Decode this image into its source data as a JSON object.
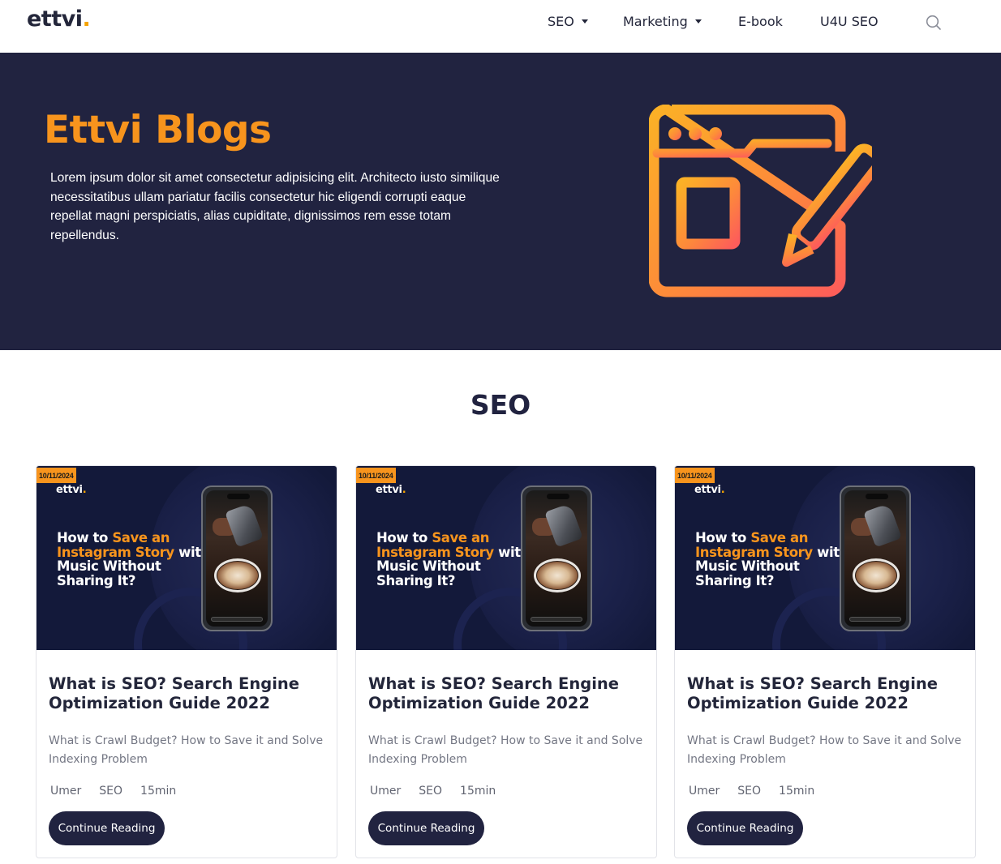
{
  "navbar": {
    "logo_text": "ettvi",
    "logo_dot": ".",
    "items": [
      {
        "label": "SEO",
        "dropdown": true
      },
      {
        "label": "Marketing",
        "dropdown": true
      },
      {
        "label": "E-book",
        "dropdown": false
      },
      {
        "label": "U4U SEO",
        "dropdown": false
      }
    ],
    "search_icon": "search-icon"
  },
  "hero": {
    "title": "Ettvi Blogs",
    "text": "Lorem ipsum dolor sit amet consectetur adipisicing elit. Architecto iusto similique necessitatibus ullam pariatur facilis consectetur hic eligendi corrupti eaque repellat magni perspiciatis, alias cupiditate, dignissimos rem esse totam repellendus.",
    "illustration_icon": "blog-writing-icon"
  },
  "section": {
    "title": "SEO"
  },
  "cards": [
    {
      "date": "10/11/2024",
      "thumb_logo": "ettvi",
      "thumb_logo_dot": ".",
      "thumb_headline_1": "How to ",
      "thumb_headline_2": "Save an Instagram Story",
      "thumb_headline_3": " with Music Without Sharing It?",
      "title": "What is SEO? Search Engine Optimization Guide 2022",
      "desc": "What is Crawl Budget? How to Save it and Solve Indexing Problem",
      "author": "Umer",
      "category": "SEO",
      "read_time": "15min",
      "button": "Continue Reading"
    },
    {
      "date": "10/11/2024",
      "thumb_logo": "ettvi",
      "thumb_logo_dot": ".",
      "thumb_headline_1": "How to ",
      "thumb_headline_2": "Save an Instagram Story",
      "thumb_headline_3": " with Music Without Sharing It?",
      "title": "What is SEO? Search Engine Optimization Guide 2022",
      "desc": "What is Crawl Budget? How to Save it and Solve Indexing Problem",
      "author": "Umer",
      "category": "SEO",
      "read_time": "15min",
      "button": "Continue Reading"
    },
    {
      "date": "10/11/2024",
      "thumb_logo": "ettvi",
      "thumb_logo_dot": ".",
      "thumb_headline_1": "How to ",
      "thumb_headline_2": "Save an Instagram Story",
      "thumb_headline_3": " with Music Without Sharing It?",
      "title": "What is SEO? Search Engine Optimization Guide 2022",
      "desc": "What is Crawl Budget? How to Save it and Solve Indexing Problem",
      "author": "Umer",
      "category": "SEO",
      "read_time": "15min",
      "button": "Continue Reading"
    }
  ],
  "colors": {
    "brand_orange": "#f7941d",
    "navy": "#212340",
    "logo_dot": "#f5a300"
  }
}
